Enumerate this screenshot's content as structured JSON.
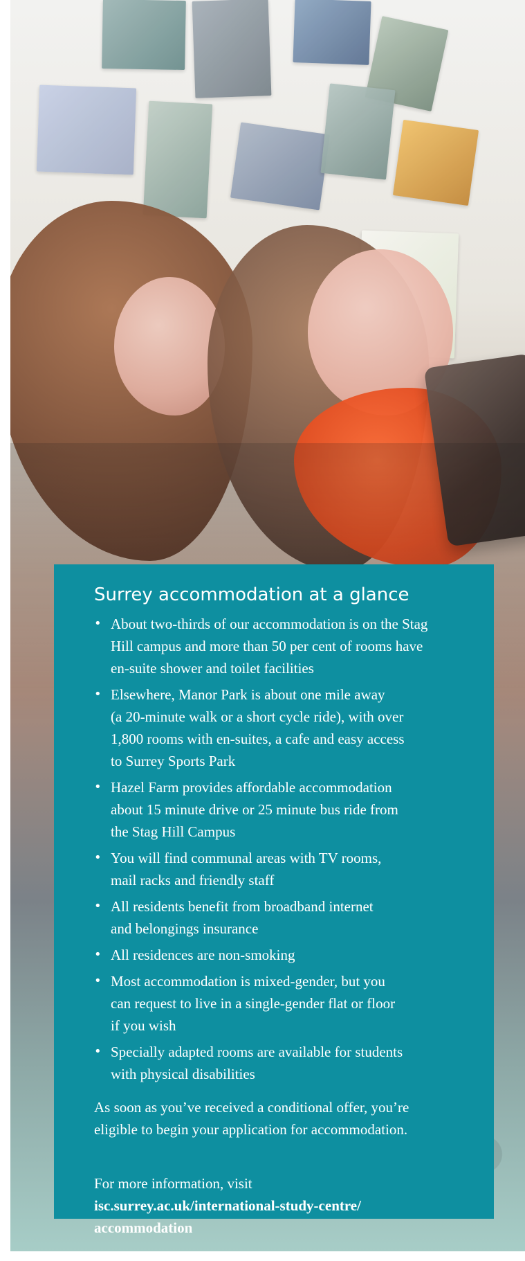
{
  "panel": {
    "title": "Surrey accommodation at a glance",
    "bullets": [
      "About two-thirds of our accommodation is on the Stag\nHill campus and more than 50 per cent of rooms have\nen-suite shower and toilet facilities",
      "Elsewhere, Manor Park is about one mile away\n(a 20-minute walk or a short cycle ride), with over\n1,800 rooms with en-suites, a cafe and easy access\nto Surrey Sports Park",
      "Hazel Farm provides affordable accommodation\nabout 15 minute drive or 25 minute bus ride from\nthe Stag Hill Campus",
      "You will find communal areas with TV rooms,\nmail racks and friendly staff",
      "All residents benefit from broadband internet\nand belongings insurance",
      "All residences are non-smoking",
      "Most accommodation is mixed-gender, but you\ncan request to live in a single-gender flat or floor\nif you wish",
      "Specially adapted rooms are available for students\nwith physical disabilities"
    ],
    "offer_paragraph": "As soon as you’ve received a conditional offer, you’re\neligible to begin your application for accommodation.",
    "more_info_prefix": "For more information, visit",
    "more_info_link": "isc.surrey.ac.uk/international-study-centre/\naccommodation"
  },
  "bullet_symbol": "•"
}
